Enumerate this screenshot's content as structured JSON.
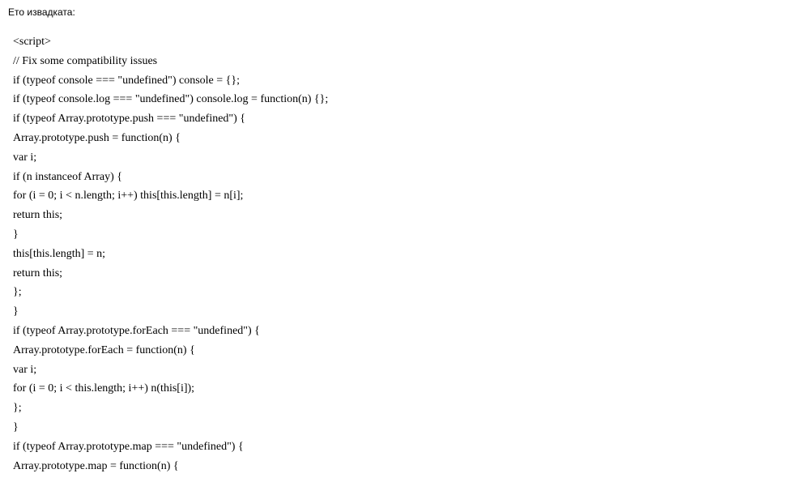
{
  "header": "Ето извадката:",
  "code_lines": [
    "<script>",
    "// Fix some compatibility issues",
    "if (typeof console === \"undefined\") console = {};",
    "if (typeof console.log === \"undefined\") console.log = function(n) {};",
    "if (typeof Array.prototype.push === \"undefined\") {",
    "Array.prototype.push = function(n) {",
    "var i;",
    "if (n instanceof Array) {",
    "for (i = 0; i < n.length; i++) this[this.length] = n[i];",
    "return this;",
    "}",
    "this[this.length] = n;",
    "return this;",
    "};",
    "}",
    "if (typeof Array.prototype.forEach === \"undefined\") {",
    "Array.prototype.forEach = function(n) {",
    "var i;",
    "for (i = 0; i < this.length; i++) n(this[i]);",
    "};",
    "}",
    "if (typeof Array.prototype.map === \"undefined\") {",
    "Array.prototype.map = function(n) {"
  ]
}
